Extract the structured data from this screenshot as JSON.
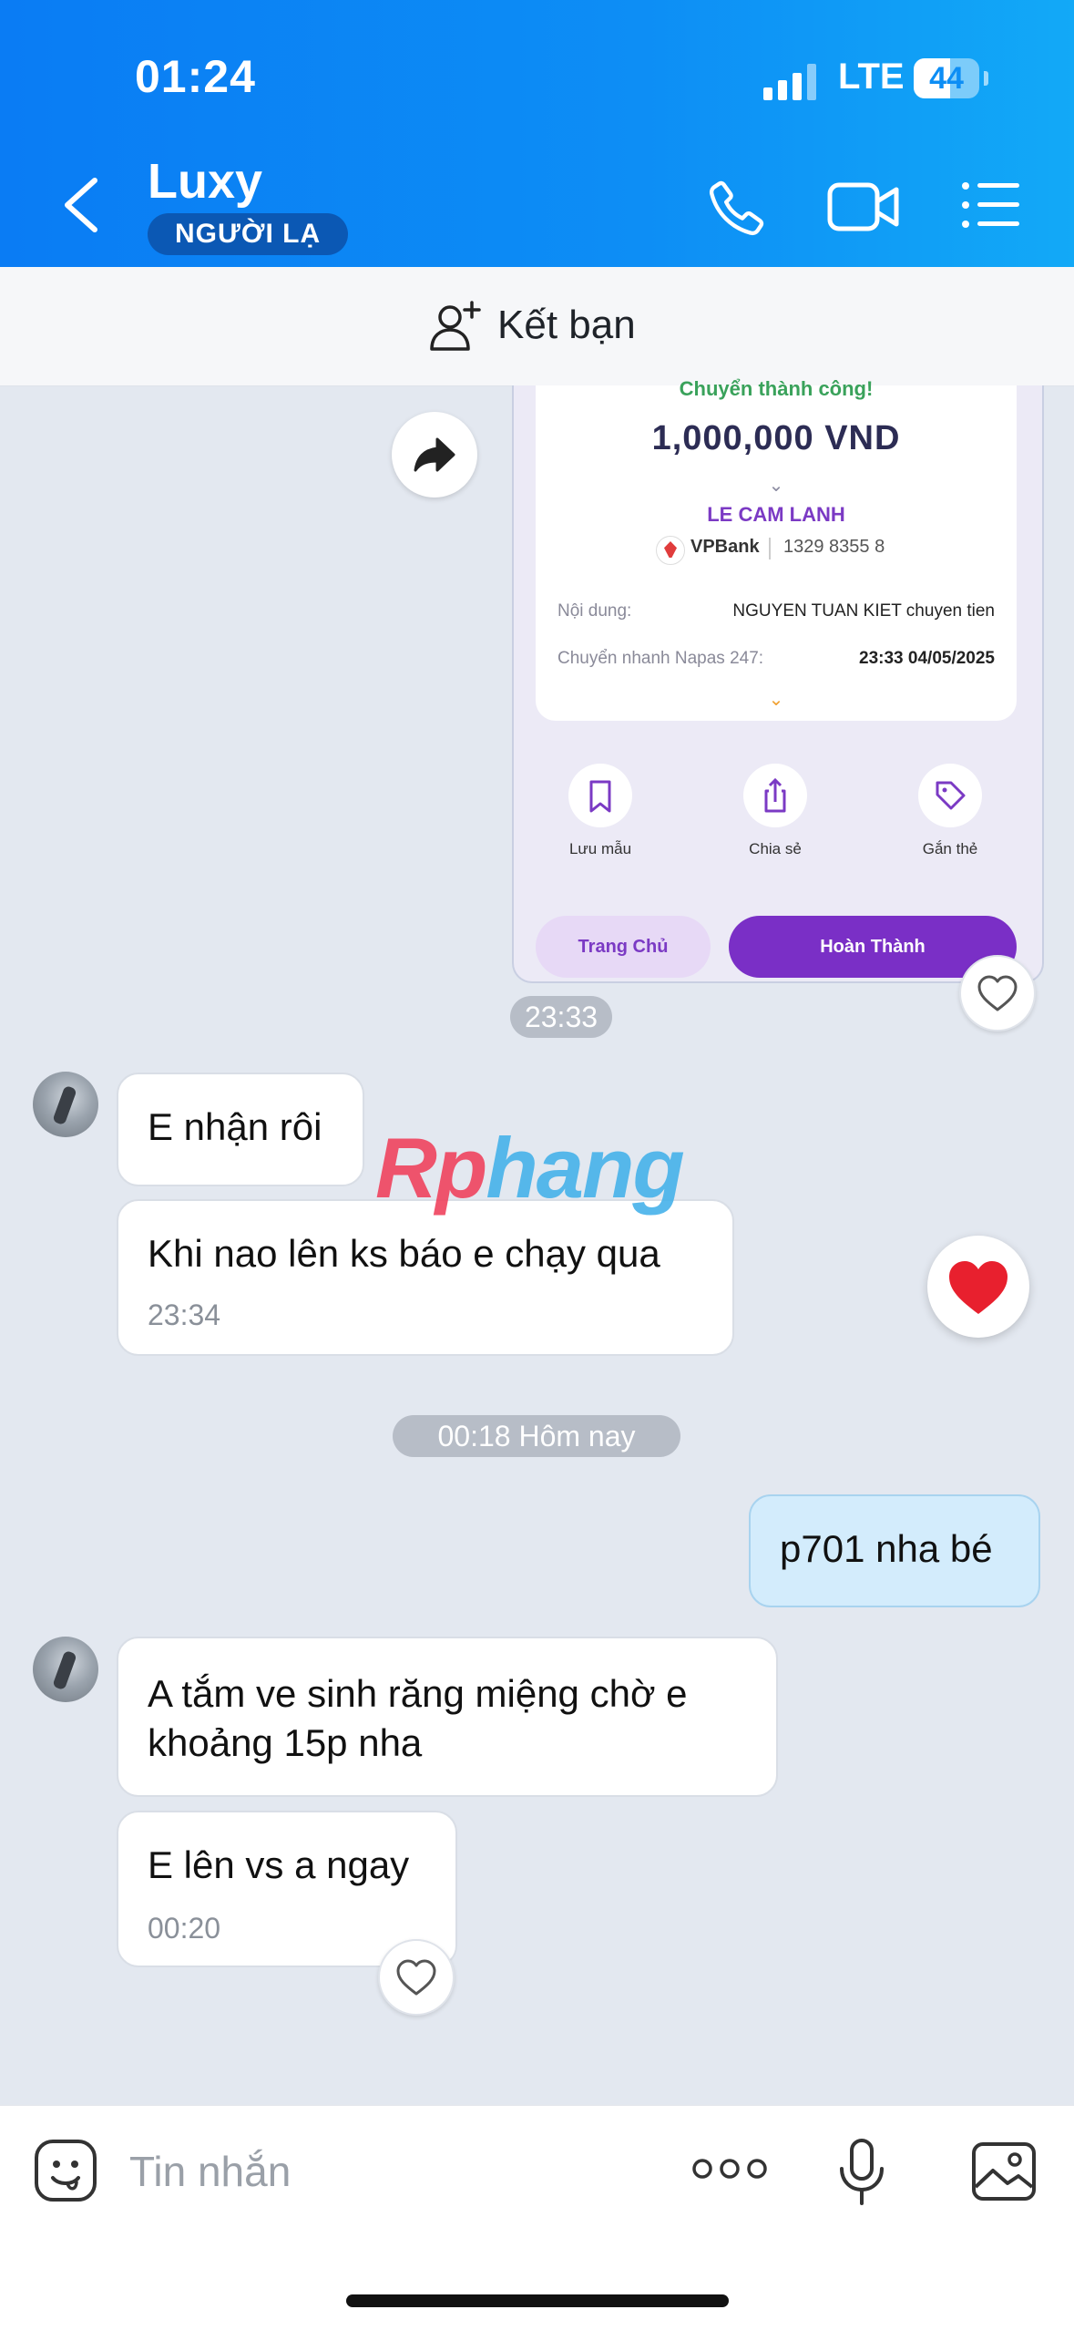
{
  "status_bar": {
    "time": "01:24",
    "network": "LTE",
    "battery": "44"
  },
  "header": {
    "contact_name": "Luxy",
    "badge": "NGƯỜI LẠ"
  },
  "add_friend": {
    "label": "Kết bạn"
  },
  "receipt": {
    "status": "Chuyển thành công!",
    "amount": "1,000,000 VND",
    "recipient": "LE CAM LANH",
    "bank": "VPBank",
    "account": "1329 8355 8",
    "content_label": "Nội dung:",
    "content_value": "NGUYEN TUAN KIET chuyen tien",
    "napas_label": "Chuyển nhanh Napas 247:",
    "napas_value": "23:33 04/05/2025",
    "actions": [
      "Lưu mẫu",
      "Chia sẻ",
      "Gắn thẻ"
    ],
    "home_button": "Trang Chủ",
    "done_button": "Hoàn Thành"
  },
  "timestamps": {
    "receipt_time": "23:33",
    "today": "00:18 Hôm nay"
  },
  "messages": [
    {
      "from": "contact",
      "text": "E nhận rôi"
    },
    {
      "from": "contact",
      "text": "Khi nao lên ks báo e chạy qua",
      "time": "23:34"
    },
    {
      "from": "me",
      "text": "p701 nha bé"
    },
    {
      "from": "contact",
      "text": "A tắm ve sinh răng miệng chờ e khoảng 15p nha"
    },
    {
      "from": "contact",
      "text": "E lên vs a ngay",
      "time": "00:20"
    }
  ],
  "watermark": {
    "part1": "Rp",
    "part2": "hang"
  },
  "input": {
    "placeholder": "Tin nhắn"
  },
  "colors": {
    "header_blue": "#0a7cf4",
    "chat_bg": "#e3e8f0",
    "my_bubble": "#d3ecfc",
    "heart_red": "#e8202e"
  }
}
